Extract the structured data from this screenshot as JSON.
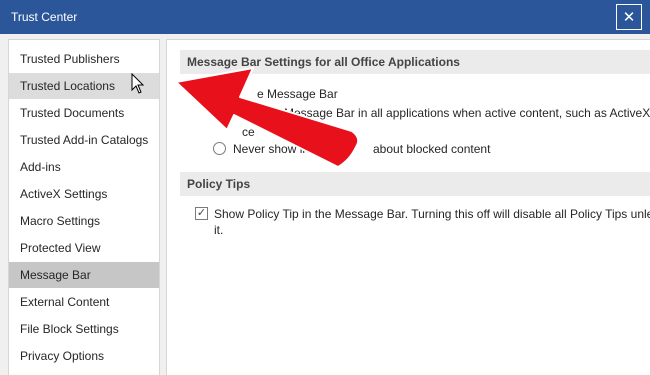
{
  "window": {
    "title": "Trust Center",
    "close_glyph": "✕"
  },
  "sidebar": {
    "items": [
      {
        "label": "Trusted Publishers"
      },
      {
        "label": "Trusted Locations"
      },
      {
        "label": "Trusted Documents"
      },
      {
        "label": "Trusted Add-in Catalogs"
      },
      {
        "label": "Add-ins"
      },
      {
        "label": "ActiveX Settings"
      },
      {
        "label": "Macro Settings"
      },
      {
        "label": "Protected View"
      },
      {
        "label": "Message Bar"
      },
      {
        "label": "External Content"
      },
      {
        "label": "File Block Settings"
      },
      {
        "label": "Privacy Options"
      }
    ]
  },
  "main": {
    "message_bar_section": {
      "header": "Message Bar Settings for all Office Applications",
      "option_show_fragment": "e Message Bar",
      "option_show_desc": "Message Bar in all applications when active content, such as ActiveX c",
      "option_partial": "ce",
      "option_never_start": "Never show in",
      "option_never_end": "about blocked content"
    },
    "policy_tips_section": {
      "header": "Policy Tips",
      "checkbox_line1": "Show Policy Tip in the Message Bar. Turning this off will disable all Policy Tips unle",
      "checkbox_line2": "it.",
      "checkbox_mark": "✓"
    }
  },
  "colors": {
    "titlebar": "#2b579a",
    "annotation_arrow": "#e8101a",
    "selected_item": "#c6c6c6"
  }
}
